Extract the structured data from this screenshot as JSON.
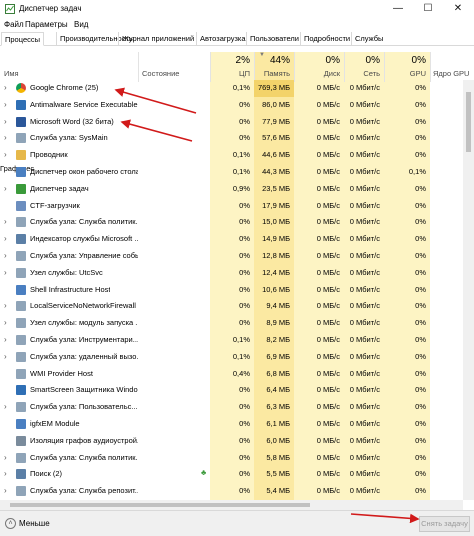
{
  "window": {
    "title": "Диспетчер задач",
    "minimize_glyph": "—",
    "maximize_glyph": "☐",
    "close_glyph": "✕"
  },
  "menu": [
    "Файл",
    "Параметры",
    "Вид"
  ],
  "tabs": [
    "Процессы",
    "Производительность",
    "Журнал приложений",
    "Автозагрузка",
    "Пользователи",
    "Подробности",
    "Службы"
  ],
  "active_tab": "Процессы",
  "columns": {
    "name": "Имя",
    "status": "Состояние",
    "cpu": {
      "pct": "2%",
      "label": "ЦП"
    },
    "memory": {
      "pct": "44%",
      "label": "Память"
    },
    "disk": {
      "pct": "0%",
      "label": "Диск"
    },
    "network": {
      "pct": "0%",
      "label": "Сеть"
    },
    "gpu": {
      "pct": "0%",
      "label": "GPU"
    },
    "gpu_engine": {
      "label": "Ядро GPU"
    }
  },
  "processes": [
    {
      "name": "Google Chrome (25)",
      "expandable": true,
      "icon": "chrome-icon",
      "cpu": "0,1%",
      "mem": "769,3 МБ",
      "disk": "0 МБ/с",
      "net": "0 Мбит/с",
      "gpu": "0%",
      "engine": "",
      "mem_highlight": true
    },
    {
      "name": "Antimalware Service Executable",
      "expandable": true,
      "icon": "shield-icon",
      "cpu": "0%",
      "mem": "86,0 МБ",
      "disk": "0 МБ/с",
      "net": "0 Мбит/с",
      "gpu": "0%",
      "engine": ""
    },
    {
      "name": "Microsoft Word (32 бита)",
      "expandable": true,
      "icon": "word-icon",
      "cpu": "0%",
      "mem": "77,9 МБ",
      "disk": "0 МБ/с",
      "net": "0 Мбит/с",
      "gpu": "0%",
      "engine": ""
    },
    {
      "name": "Служба узла: SysMain",
      "expandable": true,
      "icon": "gear-icon",
      "cpu": "0%",
      "mem": "57,6 МБ",
      "disk": "0 МБ/с",
      "net": "0 Мбит/с",
      "gpu": "0%",
      "engine": ""
    },
    {
      "name": "Проводник",
      "expandable": true,
      "icon": "folder-icon",
      "cpu": "0,1%",
      "mem": "44,6 МБ",
      "disk": "0 МБ/с",
      "net": "0 Мбит/с",
      "gpu": "0%",
      "engine": ""
    },
    {
      "name": "Диспетчер окон рабочего стола",
      "expandable": false,
      "icon": "window-icon",
      "cpu": "0,1%",
      "mem": "44,3 МБ",
      "disk": "0 МБ/с",
      "net": "0 Мбит/с",
      "gpu": "0,1%",
      "engine": "Графичес"
    },
    {
      "name": "Диспетчер задач",
      "expandable": true,
      "icon": "taskmgr-icon",
      "cpu": "0,9%",
      "mem": "23,5 МБ",
      "disk": "0 МБ/с",
      "net": "0 Мбит/с",
      "gpu": "0%",
      "engine": ""
    },
    {
      "name": "CTF-загрузчик",
      "expandable": false,
      "icon": "ctf-icon",
      "cpu": "0%",
      "mem": "17,9 МБ",
      "disk": "0 МБ/с",
      "net": "0 Мбит/с",
      "gpu": "0%",
      "engine": ""
    },
    {
      "name": "Служба узла: Служба политик...",
      "expandable": true,
      "icon": "gear-icon",
      "cpu": "0%",
      "mem": "15,0 МБ",
      "disk": "0 МБ/с",
      "net": "0 Мбит/с",
      "gpu": "0%",
      "engine": ""
    },
    {
      "name": "Индексатор службы Microsoft ...",
      "expandable": true,
      "icon": "search-icon",
      "cpu": "0%",
      "mem": "14,9 МБ",
      "disk": "0 МБ/с",
      "net": "0 Мбит/с",
      "gpu": "0%",
      "engine": ""
    },
    {
      "name": "Служба узла: Управление событи...",
      "expandable": true,
      "icon": "gear-icon",
      "cpu": "0%",
      "mem": "12,8 МБ",
      "disk": "0 МБ/с",
      "net": "0 Мбит/с",
      "gpu": "0%",
      "engine": ""
    },
    {
      "name": "Узел службы: UtcSvc",
      "expandable": true,
      "icon": "gear-icon",
      "cpu": "0%",
      "mem": "12,4 МБ",
      "disk": "0 МБ/с",
      "net": "0 Мбит/с",
      "gpu": "0%",
      "engine": ""
    },
    {
      "name": "Shell Infrastructure Host",
      "expandable": false,
      "icon": "window-icon",
      "cpu": "0%",
      "mem": "10,6 МБ",
      "disk": "0 МБ/с",
      "net": "0 Мбит/с",
      "gpu": "0%",
      "engine": ""
    },
    {
      "name": "LocalServiceNoNetworkFirewall ...",
      "expandable": true,
      "icon": "gear-icon",
      "cpu": "0%",
      "mem": "9,4 МБ",
      "disk": "0 МБ/с",
      "net": "0 Мбит/с",
      "gpu": "0%",
      "engine": ""
    },
    {
      "name": "Узел службы: модуль запуска ...",
      "expandable": true,
      "icon": "gear-icon",
      "cpu": "0%",
      "mem": "8,9 МБ",
      "disk": "0 МБ/с",
      "net": "0 Мбит/с",
      "gpu": "0%",
      "engine": ""
    },
    {
      "name": "Служба узла: Инструментари...",
      "expandable": true,
      "icon": "gear-icon",
      "cpu": "0,1%",
      "mem": "8,2 МБ",
      "disk": "0 МБ/с",
      "net": "0 Мбит/с",
      "gpu": "0%",
      "engine": ""
    },
    {
      "name": "Служба узла: удаленный вызо...",
      "expandable": true,
      "icon": "gear-icon",
      "cpu": "0,1%",
      "mem": "6,9 МБ",
      "disk": "0 МБ/с",
      "net": "0 Мбит/с",
      "gpu": "0%",
      "engine": ""
    },
    {
      "name": "WMI Provider Host",
      "expandable": false,
      "icon": "gear-icon",
      "cpu": "0,4%",
      "mem": "6,8 МБ",
      "disk": "0 МБ/с",
      "net": "0 Мбит/с",
      "gpu": "0%",
      "engine": ""
    },
    {
      "name": "SmartScreen Защитника Windo...",
      "expandable": false,
      "icon": "shield-icon",
      "cpu": "0%",
      "mem": "6,4 МБ",
      "disk": "0 МБ/с",
      "net": "0 Мбит/с",
      "gpu": "0%",
      "engine": ""
    },
    {
      "name": "Служба узла: Пользовательс...",
      "expandable": true,
      "icon": "gear-icon",
      "cpu": "0%",
      "mem": "6,3 МБ",
      "disk": "0 МБ/с",
      "net": "0 Мбит/с",
      "gpu": "0%",
      "engine": ""
    },
    {
      "name": "igfxEM Module",
      "expandable": false,
      "icon": "window-icon",
      "cpu": "0%",
      "mem": "6,1 МБ",
      "disk": "0 МБ/с",
      "net": "0 Мбит/с",
      "gpu": "0%",
      "engine": ""
    },
    {
      "name": "Изоляция графов аудиоустрой...",
      "expandable": false,
      "icon": "audio-icon",
      "cpu": "0%",
      "mem": "6,0 МБ",
      "disk": "0 МБ/с",
      "net": "0 Мбит/с",
      "gpu": "0%",
      "engine": ""
    },
    {
      "name": "Служба узла: Служба политик...",
      "expandable": true,
      "icon": "gear-icon",
      "cpu": "0%",
      "mem": "5,8 МБ",
      "disk": "0 МБ/с",
      "net": "0 Мбит/с",
      "gpu": "0%",
      "engine": ""
    },
    {
      "name": "Поиск (2)",
      "expandable": true,
      "icon": "search-icon",
      "cpu": "0%",
      "mem": "5,5 МБ",
      "disk": "0 МБ/с",
      "net": "0 Мбит/с",
      "gpu": "0%",
      "engine": "",
      "leaf": true
    },
    {
      "name": "Служба узла: Служба репозит...",
      "expandable": true,
      "icon": "gear-icon",
      "cpu": "0%",
      "mem": "5,4 МБ",
      "disk": "0 МБ/с",
      "net": "0 Мбит/с",
      "gpu": "0%",
      "engine": ""
    }
  ],
  "footer": {
    "fewer_details": "Меньше",
    "end_task": "Снять задачу"
  },
  "colors": {
    "cpu_column": "#fdf4c4",
    "memory_column": "#fbe9a2",
    "memory_highlight": "#f3d36a",
    "annotation_arrow": "#d11a1a"
  }
}
